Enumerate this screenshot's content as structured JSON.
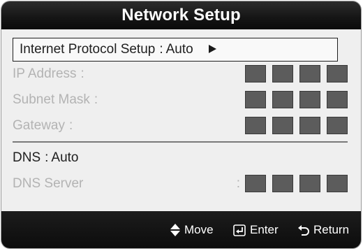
{
  "title": "Network Setup",
  "rows": {
    "protocol": {
      "label": "Internet Protocol Setup",
      "separator": ":",
      "value": "Auto"
    },
    "ip": {
      "label": "IP Address",
      "separator": ":"
    },
    "subnet": {
      "label": "Subnet Mask",
      "separator": ":"
    },
    "gateway": {
      "label": "Gateway",
      "separator": ":"
    },
    "dns": {
      "label": "DNS",
      "separator": ":",
      "value": "Auto"
    },
    "dns_server": {
      "label": "DNS Server",
      "separator": ":"
    }
  },
  "footer": {
    "move": "Move",
    "enter": "Enter",
    "return": "Return"
  },
  "icons": {
    "selected_arrow": "right-triangle-icon",
    "move": "up-down-arrows-icon",
    "enter": "enter-icon",
    "return": "return-icon"
  },
  "colors": {
    "header_bg": "#151515",
    "panel_bg": "#efefef",
    "octet": "#5c5c5c",
    "disabled_text": "#b3b3b3"
  }
}
